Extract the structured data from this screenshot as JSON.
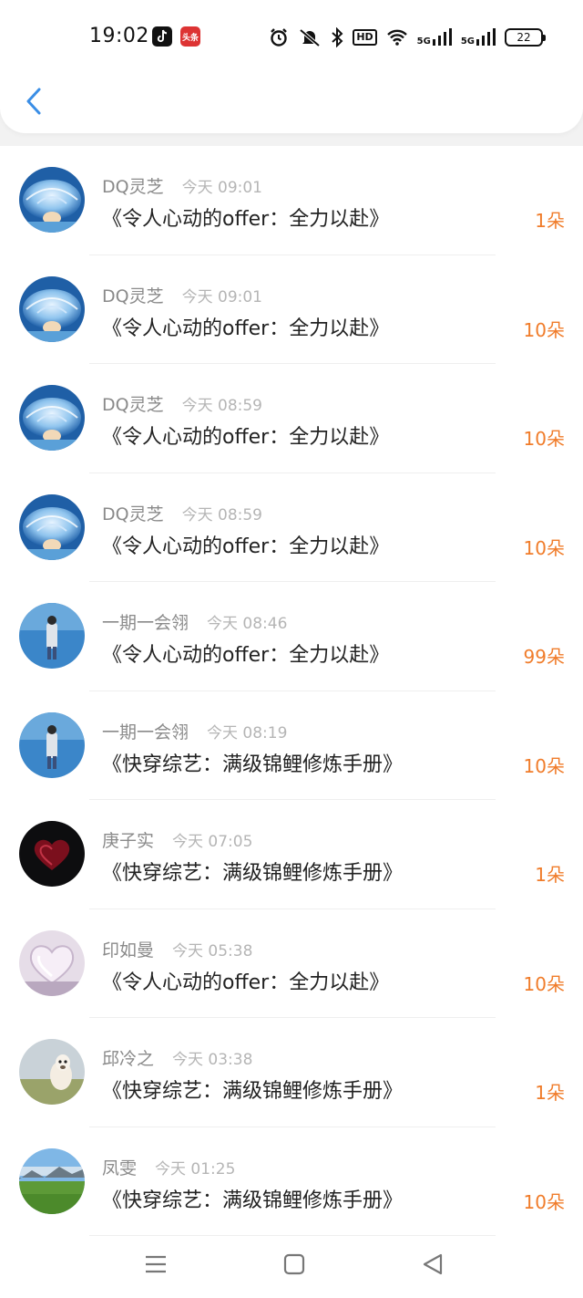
{
  "status_bar": {
    "time": "19:02",
    "app_badges": [
      "tiktok-icon",
      "news-app-icon"
    ],
    "red_badge_text": "头条",
    "hd_label": "HD",
    "signal_labels": [
      "5G",
      "5G"
    ],
    "battery": "22"
  },
  "header": {
    "back_icon": "chevron-left-icon"
  },
  "colors": {
    "accent": "#3a8ee6",
    "amount": "#f07c2a",
    "name": "#8a8a8a",
    "time": "#b5b5b5"
  },
  "gifts": [
    {
      "name": "DQ灵芝",
      "time": "今天 09:01",
      "title": "《令人心动的offer：全力以赴》",
      "amount": "1朵",
      "avatar": "jellyfish"
    },
    {
      "name": "DQ灵芝",
      "time": "今天 09:01",
      "title": "《令人心动的offer：全力以赴》",
      "amount": "10朵",
      "avatar": "jellyfish"
    },
    {
      "name": "DQ灵芝",
      "time": "今天 08:59",
      "title": "《令人心动的offer：全力以赴》",
      "amount": "10朵",
      "avatar": "jellyfish"
    },
    {
      "name": "DQ灵芝",
      "time": "今天 08:59",
      "title": "《令人心动的offer：全力以赴》",
      "amount": "10朵",
      "avatar": "jellyfish"
    },
    {
      "name": "一期一会翎",
      "time": "今天 08:46",
      "title": "《令人心动的offer：全力以赴》",
      "amount": "99朵",
      "avatar": "sea-person"
    },
    {
      "name": "一期一会翎",
      "time": "今天 08:19",
      "title": "《快穿综艺：满级锦鲤修炼手册》",
      "amount": "10朵",
      "avatar": "sea-person"
    },
    {
      "name": "庚子实",
      "time": "今天 07:05",
      "title": "《快穿综艺：满级锦鲤修炼手册》",
      "amount": "1朵",
      "avatar": "dark-heart"
    },
    {
      "name": "印如曼",
      "time": "今天 05:38",
      "title": "《令人心动的offer：全力以赴》",
      "amount": "10朵",
      "avatar": "glass-heart"
    },
    {
      "name": "邱冷之",
      "time": "今天 03:38",
      "title": "《快穿综艺：满级锦鲤修炼手册》",
      "amount": "1朵",
      "avatar": "alpaca"
    },
    {
      "name": "凤雯",
      "time": "今天 01:25",
      "title": "《快穿综艺：满级锦鲤修炼手册》",
      "amount": "10朵",
      "avatar": "meadow"
    }
  ],
  "nav": [
    "menu-icon",
    "home-square-icon",
    "back-triangle-icon"
  ]
}
